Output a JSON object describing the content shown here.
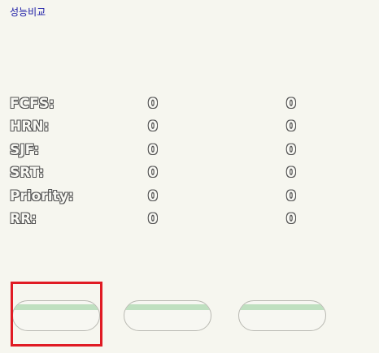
{
  "header": {
    "title": "성능비교"
  },
  "results": [
    {
      "label": "FCFS:",
      "value_a": "0",
      "value_b": "0"
    },
    {
      "label": "HRN:",
      "value_a": "0",
      "value_b": "0"
    },
    {
      "label": "SJF:",
      "value_a": "0",
      "value_b": "0"
    },
    {
      "label": "SRT:",
      "value_a": "0",
      "value_b": "0"
    },
    {
      "label": "Priority:",
      "value_a": "0",
      "value_b": "0"
    },
    {
      "label": "RR:",
      "value_a": "0",
      "value_b": "0"
    }
  ],
  "buttons": [
    {
      "label": ""
    },
    {
      "label": ""
    },
    {
      "label": ""
    }
  ],
  "colors": {
    "selection": "#e01b24",
    "button_stripe": "#bfe0c0",
    "link": "#1a1aa6"
  }
}
